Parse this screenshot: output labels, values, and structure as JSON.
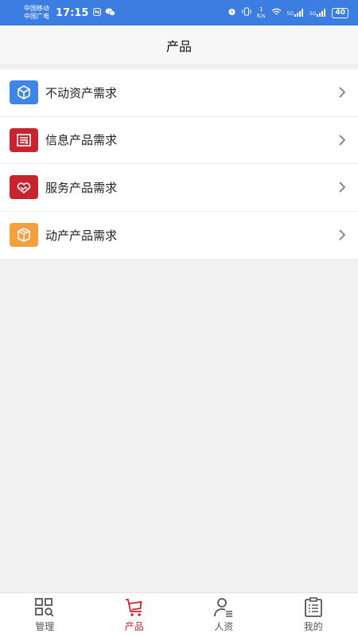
{
  "status_bar": {
    "carrier1": "中国移动",
    "carrier2": "中国广电",
    "time": "17:15",
    "net_speed_value": "1",
    "net_speed_unit": "K/s",
    "signal1": "5G",
    "signal2": "5G",
    "battery": "40"
  },
  "header": {
    "title": "产品"
  },
  "items": [
    {
      "label": "不动资产需求",
      "icon": "cube-icon",
      "color": "#3d86e6"
    },
    {
      "label": "信息产品需求",
      "icon": "document-icon",
      "color": "#c8242f"
    },
    {
      "label": "服务产品需求",
      "icon": "handshake-icon",
      "color": "#c8242f"
    },
    {
      "label": "动产产品需求",
      "icon": "box-icon",
      "color": "#f5a040"
    }
  ],
  "tabs": [
    {
      "label": "管理",
      "icon": "grid-search-icon",
      "active": false
    },
    {
      "label": "产品",
      "icon": "cart-icon",
      "active": true
    },
    {
      "label": "人资",
      "icon": "person-list-icon",
      "active": false
    },
    {
      "label": "我的",
      "icon": "clipboard-icon",
      "active": false
    }
  ],
  "colors": {
    "accent": "#c8242f",
    "status_bar": "#3b7de0"
  }
}
